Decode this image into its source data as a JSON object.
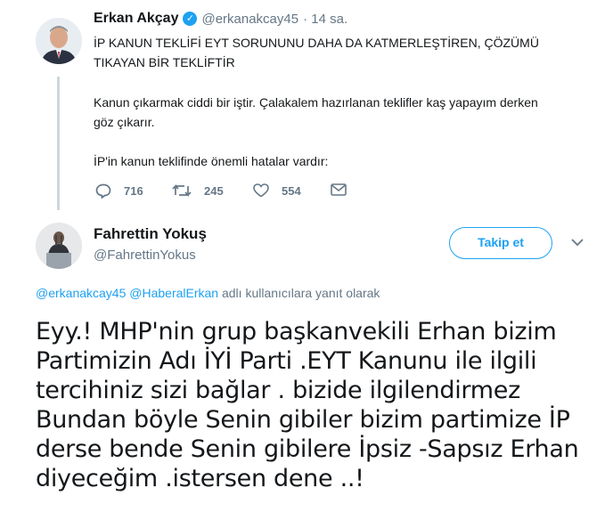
{
  "tweet1": {
    "name": "Erkan Akçay",
    "handle": "@erkanakcay45",
    "time": "· 14 sa.",
    "line1": "İP KANUN TEKLİFİ EYT SORUNUNU DAHA DA KATMERLEŞTİREN, ÇÖZÜMÜ",
    "line2": "TIKAYAN BİR TEKLİFTİR",
    "line3": "Kanun çıkarmak ciddi bir iştir. Çalakalem hazırlanan teklifler kaş yapayım derken",
    "line4": "göz çıkarır.",
    "line5": "İP'in kanun teklifinde önemli hatalar vardır:",
    "replies": "716",
    "retweets": "245",
    "likes": "554"
  },
  "tweet2": {
    "name": "Fahrettin Yokuş",
    "handle": "@FahrettinYokus",
    "follow_label": "Takip et",
    "reply_mention1": "@erkanakcay45",
    "reply_mention2": "@HaberalErkan",
    "reply_suffix": "adlı kullanıcılara yanıt olarak",
    "body1": "Eyy.! MHP'nin  grup başkanvekili Erhan bizim",
    "body2": "Partimizin Adı İYİ Parti .EYT Kanunu ile ilgili",
    "body3": "tercihiniz sizi bağlar . bizide ilgilendirmez",
    "body4": "Bundan böyle Senin gibiler bizim partimize İP",
    "body5": "derse bende Senin gibilere İpsiz -Sapsız Erhan",
    "body6": "diyeceğim .istersen dene ..!"
  },
  "colors": {
    "accent": "#1da1f2",
    "muted": "#657786",
    "thread": "#ccd6dd"
  }
}
